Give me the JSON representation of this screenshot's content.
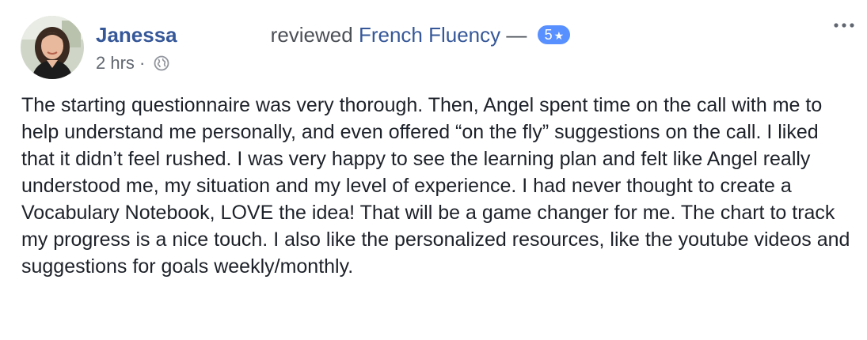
{
  "post": {
    "author": {
      "name": "Janessa",
      "avatar_icon": "profile-photo"
    },
    "action_text": "reviewed",
    "page_name": "French Fluency",
    "dash": "—",
    "rating": {
      "value": "5",
      "star_icon": "star-icon",
      "badge_color": "#5890ff"
    },
    "timestamp": "2 hrs",
    "separator": "·",
    "privacy_icon": "public-globe-icon",
    "more_icon": "more-options-icon",
    "review_text": "The starting questionnaire was very thorough. Then, Angel spent time on the call with me to help understand me personally, and even offered “on the fly” suggestions on the call. I liked that it didn’t feel rushed. I was very happy to see the learning plan and felt like Angel really understood me, my situation and my level of experience. I had never thought to create a Vocabulary Notebook, LOVE the idea! That will be a game changer for me. The chart to track my progress is a nice touch. I also like the personalized resources, like the youtube videos and suggestions for goals weekly/monthly."
  },
  "colors": {
    "link": "#365899",
    "text": "#1d2129",
    "meta": "#616770"
  }
}
